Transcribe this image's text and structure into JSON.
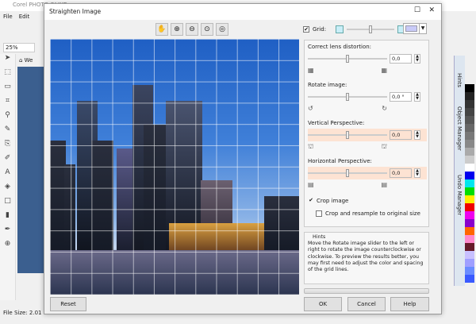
{
  "app": {
    "title": "Corel PHOTO-PAINT",
    "menu": [
      "File",
      "Edit"
    ],
    "zoom": "25%",
    "status": "File Size: 2.01",
    "tab": "We",
    "docker_tabs": [
      "Hints",
      "Object Manager",
      "Undo Manager"
    ]
  },
  "palette": [
    "#000000",
    "#222222",
    "#333333",
    "#444444",
    "#555555",
    "#666666",
    "#777777",
    "#888888",
    "#aaaaaa",
    "#cccccc",
    "#ffffff",
    "#0000ee",
    "#00e5ee",
    "#00dd00",
    "#ffee00",
    "#ee0000",
    "#ee00ee",
    "#8800cc",
    "#ff6600",
    "#ff88cc",
    "#661a2a",
    "#c8c0ff",
    "#9f9fff",
    "#6a8cff",
    "#3a5aff"
  ],
  "dialog": {
    "title": "Straighten Image",
    "toolbar": [
      "hand-icon",
      "zoom-in-icon",
      "zoom-out-icon",
      "zoom-fit-icon",
      "zoom-100-icon"
    ],
    "grid": {
      "label": "Grid:",
      "checked": true,
      "grid_size": 0.5,
      "color": "#c9cbf8"
    },
    "lens": {
      "label": "Correct lens distortion:",
      "value": "0,0",
      "slider": 0.5
    },
    "rotate": {
      "label": "Rotate image:",
      "value": "0,0 °",
      "slider": 0.5
    },
    "vertical": {
      "label": "Vertical Perspective:",
      "value": "0,0",
      "slider": 0.5
    },
    "horizontal": {
      "label": "Horizontal Perspective:",
      "value": "0,0",
      "slider": 0.5
    },
    "crop": {
      "label": "Crop image",
      "checked": true
    },
    "resample": {
      "label": "Crop and resample to original size",
      "checked": false
    },
    "hints": {
      "title": "Hints",
      "text": "Move the Rotate image slider to the left or right to rotate the image counterclockwise or clockwise. To preview the results better, you may first need to adjust the color and spacing of the grid lines."
    },
    "buttons": {
      "reset": "Reset",
      "ok": "OK",
      "cancel": "Cancel",
      "help": "Help"
    }
  }
}
